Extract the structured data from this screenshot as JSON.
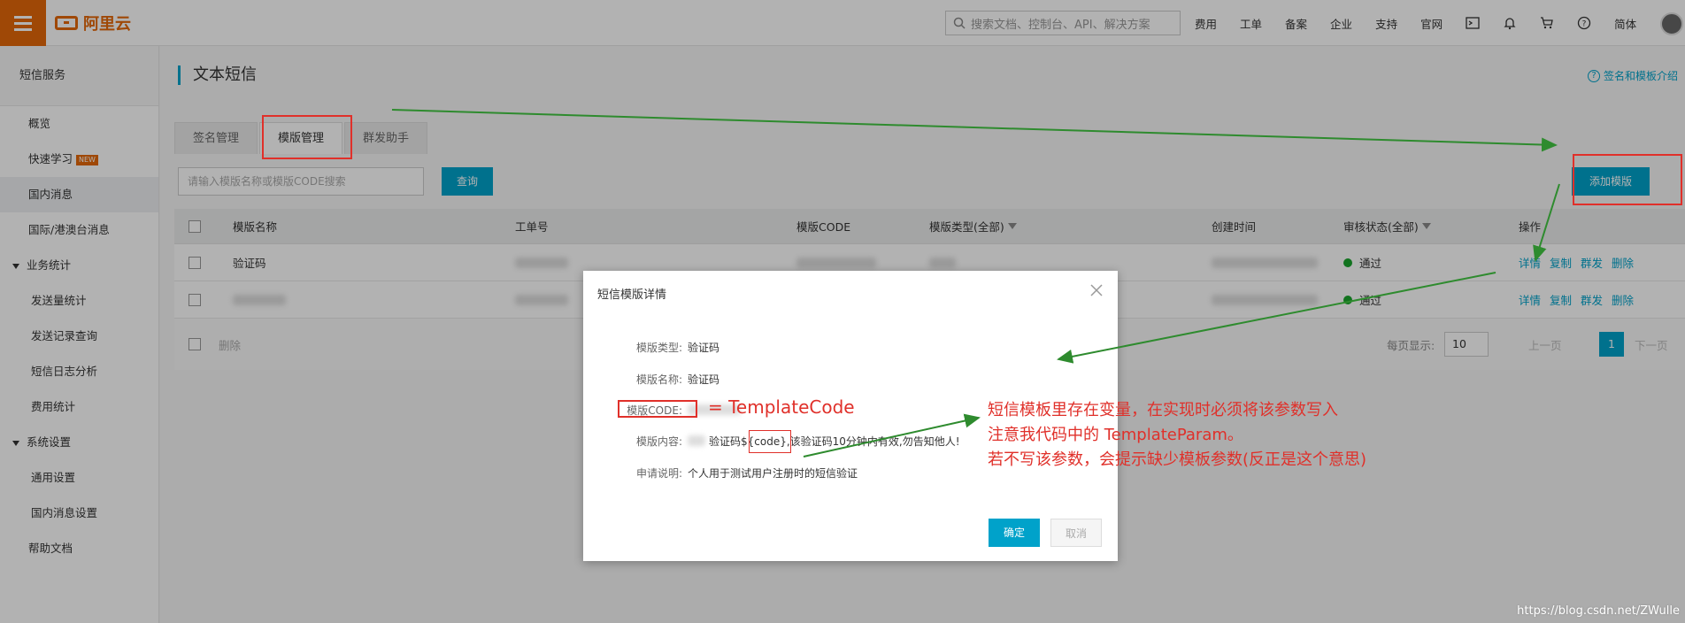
{
  "topbar": {
    "logo": "阿里云",
    "search_placeholder": "搜索文档、控制台、API、解决方案",
    "nav": [
      "费用",
      "工单",
      "备案",
      "企业",
      "支持",
      "官网"
    ],
    "lang": "简体",
    "icons": [
      "terminal-icon",
      "bell-icon",
      "cart-icon",
      "help-icon"
    ]
  },
  "sidebar": {
    "title": "短信服务",
    "items": [
      {
        "label": "概览"
      },
      {
        "label": "快速学习",
        "badge": "NEW"
      },
      {
        "label": "国内消息"
      },
      {
        "label": "国际/港澳台消息"
      }
    ],
    "group1": "业务统计",
    "group1_items": [
      "发送量统计",
      "发送记录查询",
      "短信日志分析",
      "费用统计"
    ],
    "group2": "系统设置",
    "group2_items": [
      "通用设置",
      "国内消息设置"
    ],
    "help": "帮助文档"
  },
  "main": {
    "title": "文本短信",
    "help_link": "签名和模板介绍",
    "tabs": [
      "签名管理",
      "模版管理",
      "群发助手"
    ],
    "search_placeholder": "请输入模版名称或模版CODE搜索",
    "query_button": "查询",
    "add_button": "添加模版",
    "table": {
      "headers": [
        "模版名称",
        "工单号",
        "模版CODE",
        "模版类型(全部)",
        "创建时间",
        "审核状态(全部)",
        "操作"
      ],
      "rows": [
        {
          "name": "验证码",
          "status": "通过"
        },
        {
          "name": "",
          "status": "通过"
        }
      ],
      "ops": [
        "详情",
        "复制",
        "群发",
        "删除"
      ],
      "footer_delete": "删除",
      "page_size_label": "每页显示:",
      "page_size": "10",
      "prev": "上一页",
      "current_page": "1",
      "next": "下一页"
    }
  },
  "modal": {
    "title": "短信模版详情",
    "fields": [
      {
        "label": "模版类型:",
        "value": "验证码"
      },
      {
        "label": "模版名称:",
        "value": "验证码"
      },
      {
        "label": "模版CODE:",
        "value": ""
      },
      {
        "label": "模版内容:",
        "value": "验证码${code},该验证码10分钟内有效,勿告知他人!"
      },
      {
        "label": "申请说明:",
        "value": "个人用于测试用户注册时的短信验证"
      }
    ],
    "confirm": "确定",
    "cancel": "取消"
  },
  "annotations": {
    "template_code": "= TemplateCode",
    "line1": "短信模板里存在变量，在实现时必须将该参数写入",
    "line2": "注意我代码中的 TemplateParam。",
    "line3": "若不写该参数，会提示缺少模板参数(反正是这个意思)"
  },
  "watermark": "https://blog.csdn.net/ZWulle"
}
